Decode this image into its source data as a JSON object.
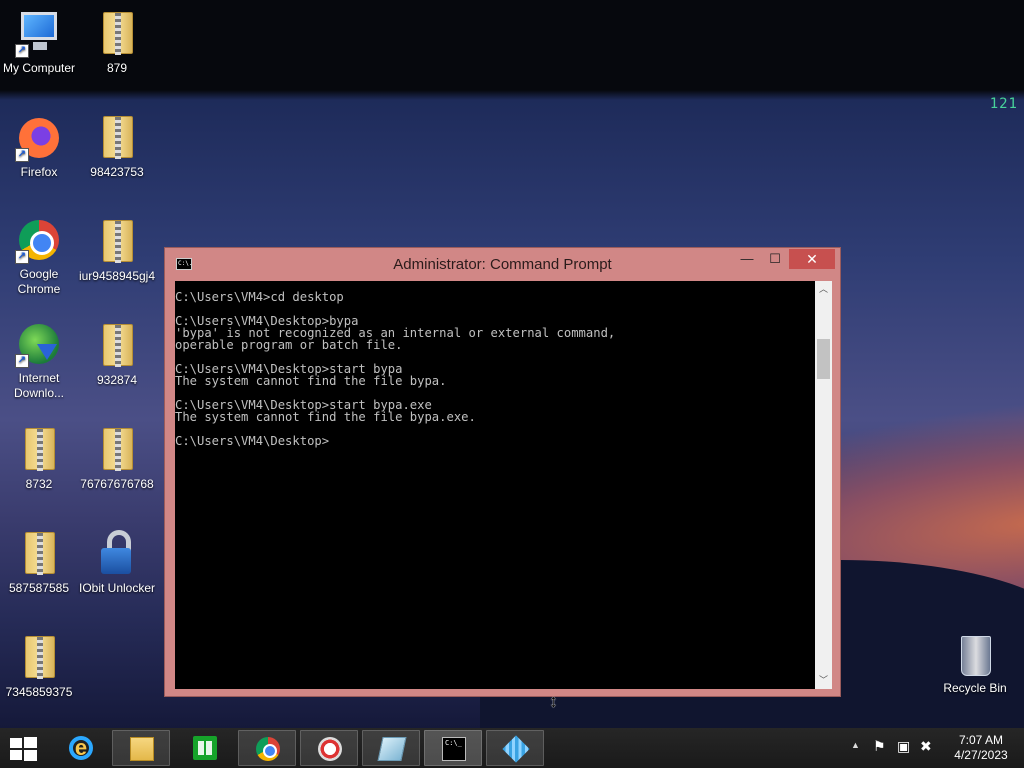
{
  "desktop": {
    "corner_text": "121",
    "icons": [
      {
        "label": "My Computer",
        "kind": "computer"
      },
      {
        "label": "879",
        "kind": "zip"
      },
      {
        "label": "Firefox",
        "kind": "firefox"
      },
      {
        "label": "98423753",
        "kind": "zip"
      },
      {
        "label": "Google Chrome",
        "kind": "chrome"
      },
      {
        "label": "iur9458945gj4",
        "kind": "zip"
      },
      {
        "label": "Internet Downlo...",
        "kind": "idm"
      },
      {
        "label": "932874",
        "kind": "zip"
      },
      {
        "label": "8732",
        "kind": "zip"
      },
      {
        "label": "76767676768",
        "kind": "zip"
      },
      {
        "label": "587587585",
        "kind": "zip"
      },
      {
        "label": "IObit Unlocker",
        "kind": "iobit"
      },
      {
        "label": "7345859375",
        "kind": "zip"
      },
      {
        "label": "Recycle Bin",
        "kind": "recycle"
      }
    ]
  },
  "window": {
    "title": "Administrator: Command Prompt",
    "icon_text": "C:\\.",
    "minimize": "—",
    "maximize": "☐",
    "close": "✕",
    "console_lines": [
      "C:\\Users\\VM4>cd desktop",
      "",
      "C:\\Users\\VM4\\Desktop>bypa",
      "'bypa' is not recognized as an internal or external command,",
      "operable program or batch file.",
      "",
      "C:\\Users\\VM4\\Desktop>start bypa",
      "The system cannot find the file bypa.",
      "",
      "C:\\Users\\VM4\\Desktop>start bypa.exe",
      "The system cannot find the file bypa.exe.",
      "",
      "C:\\Users\\VM4\\Desktop>"
    ]
  },
  "taskbar": {
    "cmd_icon_text": "C:\\_",
    "tray_up": "▲",
    "tray_flag": "⚑",
    "tray_network": "▣",
    "tray_volume": "✖",
    "time": "7:07 AM",
    "date": "4/27/2023"
  },
  "colors": {
    "window_frame": "#d18786",
    "close_button": "#c7504f",
    "console_bg": "#000000",
    "console_text": "#c0c0c0",
    "taskbar": "#1f1f1f"
  }
}
